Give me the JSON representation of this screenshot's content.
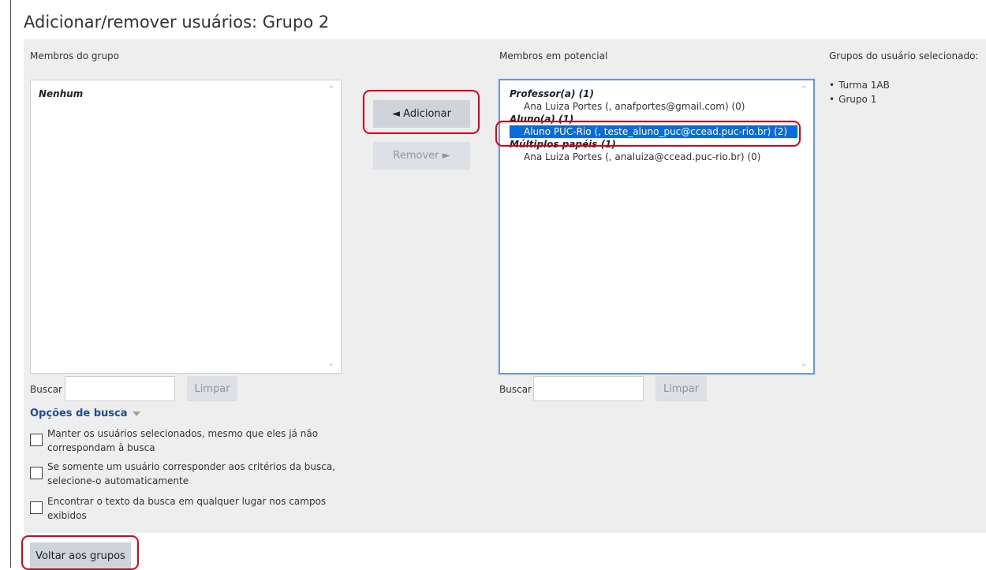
{
  "page": {
    "title": "Adicionar/remover usuários: Grupo 2"
  },
  "group_members": {
    "label": "Membros do grupo",
    "empty_text": "Nenhum",
    "search_label": "Buscar",
    "search_value": "",
    "clear_label": "Limpar"
  },
  "actions": {
    "add_label": "◄ Adicionar",
    "remove_label": "Remover ►"
  },
  "potential_members": {
    "label": "Membros em potencial",
    "groups": [
      {
        "heading": "Professor(a) (1)",
        "options": [
          {
            "text": "Ana Luiza Portes (, anafportes@gmail.com) (0)",
            "selected": false
          }
        ]
      },
      {
        "heading": "Aluno(a) (1)",
        "options": [
          {
            "text": "Aluno PUC-Rio (, teste_aluno_puc@ccead.puc-rio.br) (2)",
            "selected": true
          }
        ]
      },
      {
        "heading": "Múltiplos papéis (1)",
        "options": [
          {
            "text": "Ana Luiza Portes (, analuiza@ccead.puc-rio.br) (0)",
            "selected": false
          }
        ]
      }
    ],
    "search_label": "Buscar",
    "search_value": "",
    "clear_label": "Limpar"
  },
  "user_groups": {
    "label": "Grupos do usuário selecionado:",
    "items": [
      "Turma 1AB",
      "Grupo 1"
    ]
  },
  "search_options": {
    "toggle_label": "Opções de busca",
    "checkboxes": [
      {
        "label": "Manter os usuários selecionados, mesmo que eles já não correspondam à busca",
        "checked": false
      },
      {
        "label": "Se somente um usuário corresponder aos critérios da busca, selecione-o automaticamente",
        "checked": false
      },
      {
        "label": "Encontrar o texto da busca em qualquer lugar nos campos exibidos",
        "checked": false
      }
    ]
  },
  "footer": {
    "back_label": "Voltar aos grupos"
  },
  "colors": {
    "selection": "#0a6cd8",
    "highlight": "#e0001a",
    "panel": "#eeeeee",
    "link": "#1f4e8e"
  }
}
